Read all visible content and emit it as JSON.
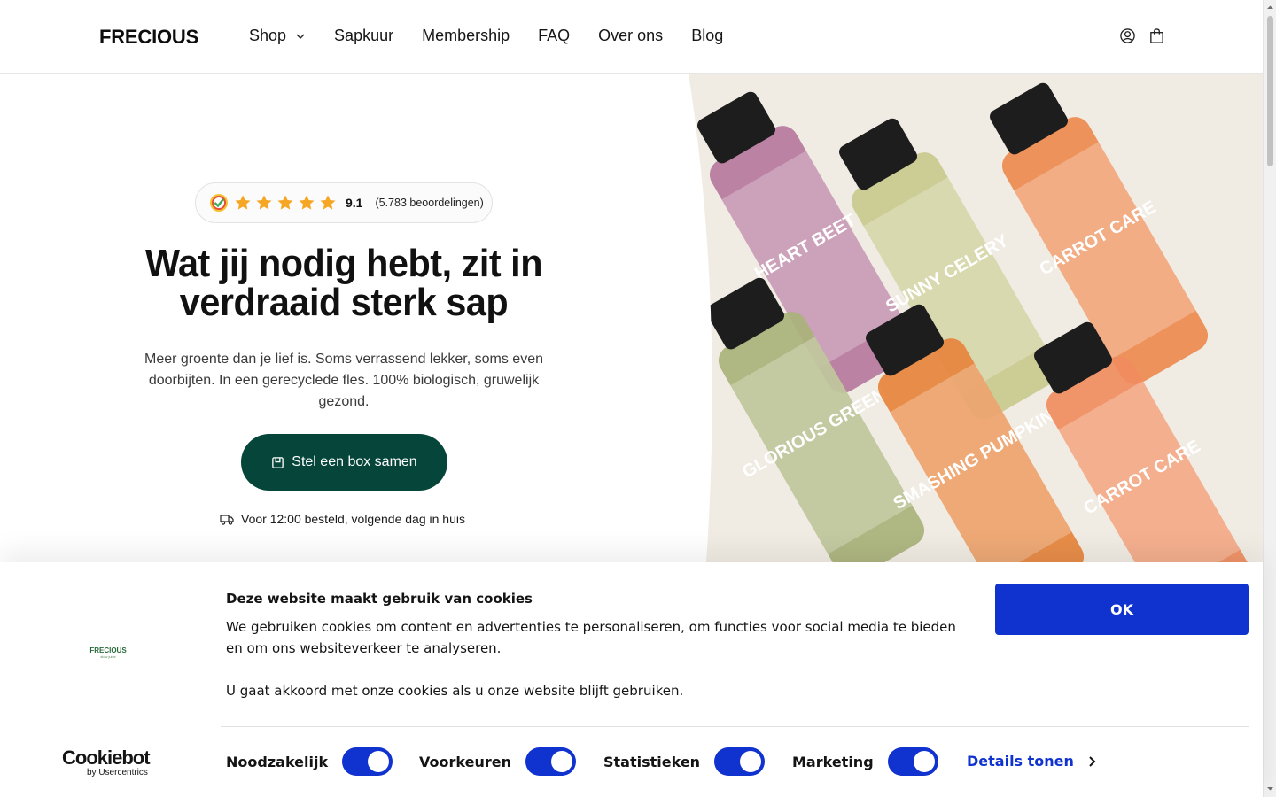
{
  "header": {
    "logo": "FRECIOUS",
    "nav": [
      {
        "label": "Shop",
        "has_dropdown": true
      },
      {
        "label": "Sapkuur"
      },
      {
        "label": "Membership"
      },
      {
        "label": "FAQ"
      },
      {
        "label": "Over ons"
      },
      {
        "label": "Blog"
      }
    ],
    "icons": [
      "account-icon",
      "cart-icon"
    ]
  },
  "hero": {
    "rating": {
      "score": "9.1",
      "stars": 5,
      "reviews": "(5.783 beoordelingen)"
    },
    "title": "Wat jij nodig hebt, zit in verdraaid sterk sap",
    "subtitle": "Meer groente dan je lief is. Soms verrassend lekker, soms even doorbijten. In een gerecyclede fles. 100% biologisch, gruwelijk gezond.",
    "cta": "Stel een box samen",
    "delivery": "Voor 12:00 besteld, volgende dag in huis",
    "bottles": [
      {
        "label": "HEART BEET",
        "color": "#b6789d"
      },
      {
        "label": "SUNNY CELERY",
        "color": "#c9c98e"
      },
      {
        "label": "CARROT CARE",
        "color": "#ee8a50"
      },
      {
        "label": "GLORIOUS GREEN",
        "color": "#a9b27a"
      },
      {
        "label": "SMASHING PUMPKIN",
        "color": "#e7843c"
      },
      {
        "label": "CARROT CARE",
        "color": "#f08c5e"
      }
    ]
  },
  "cookie_banner": {
    "logo": "FRECIOUS",
    "logo_sub": "slow juice",
    "title": "Deze website maakt gebruik van cookies",
    "text": "We gebruiken cookies om content en advertenties te personaliseren, om functies voor social media te bieden en om ons websiteverkeer te analyseren.",
    "text2": "U gaat akkoord met onze cookies als u onze website blijft gebruiken.",
    "ok": "OK",
    "provider": "Cookiebot",
    "provider_sub": "by Usercentrics",
    "toggles": [
      {
        "label": "Noodzakelijk",
        "on": true
      },
      {
        "label": "Voorkeuren",
        "on": true
      },
      {
        "label": "Statistieken",
        "on": true
      },
      {
        "label": "Marketing",
        "on": true
      }
    ],
    "details": "Details tonen"
  },
  "colors": {
    "cta": "#06463a",
    "cookie_accent": "#1032cf",
    "star": "#f5a623"
  }
}
